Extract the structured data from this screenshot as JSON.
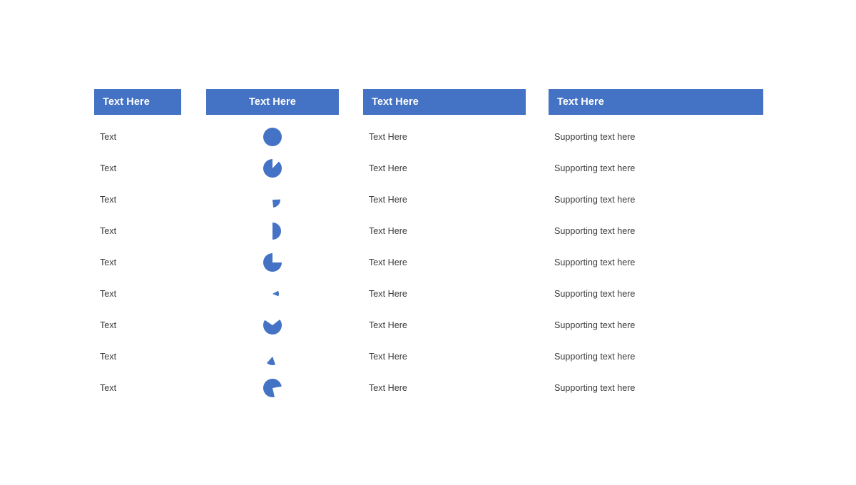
{
  "theme": {
    "accent_color": "#4472c4",
    "header_text_color": "#ffffff",
    "body_text_color": "#3b3b3b",
    "page_background": "#ffffff"
  },
  "table": {
    "headers": [
      {
        "label": "Text Here",
        "align": "left"
      },
      {
        "label": "Text Here",
        "align": "center"
      },
      {
        "label": "Text Here",
        "align": "left"
      },
      {
        "label": "Text Here",
        "align": "left"
      }
    ],
    "rows": [
      {
        "label": "Text",
        "middle": "Text Here",
        "support": "Supporting text here"
      },
      {
        "label": "Text",
        "middle": "Text Here",
        "support": "Supporting text here"
      },
      {
        "label": "Text",
        "middle": "Text Here",
        "support": "Supporting text here"
      },
      {
        "label": "Text",
        "middle": "Text Here",
        "support": "Supporting text here"
      },
      {
        "label": "Text",
        "middle": "Text Here",
        "support": "Supporting text here"
      },
      {
        "label": "Text",
        "middle": "Text Here",
        "support": "Supporting text here"
      },
      {
        "label": "Text",
        "middle": "Text Here",
        "support": "Supporting text here"
      },
      {
        "label": "Text",
        "middle": "Text Here",
        "support": "Supporting text here"
      },
      {
        "label": "Text",
        "middle": "Text Here",
        "support": "Supporting text here"
      }
    ]
  },
  "chart_data": {
    "type": "pie",
    "title": "",
    "xlabel": "",
    "ylabel": "",
    "legend": [],
    "color": "#4472c4",
    "note": "One single-slice pie icon per table row; value is the filled fraction of the circle, start_deg measured clockwise from 12 o'clock.",
    "series": [
      {
        "name": "Row 1",
        "value": 100,
        "start_deg": 0,
        "radius_px": 13
      },
      {
        "name": "Row 2",
        "value": 88,
        "start_deg": 43,
        "radius_px": 13
      },
      {
        "name": "Row 3",
        "value": 24,
        "start_deg": 88,
        "radius_px": 11
      },
      {
        "name": "Row 4",
        "value": 50,
        "start_deg": 0,
        "radius_px": 12
      },
      {
        "name": "Row 5",
        "value": 75,
        "start_deg": 90,
        "radius_px": 13
      },
      {
        "name": "Row 6",
        "value": 14,
        "start_deg": 62,
        "radius_px": 9
      },
      {
        "name": "Row 7",
        "value": 70,
        "start_deg": 52,
        "radius_px": 13
      },
      {
        "name": "Row 8",
        "value": 17,
        "start_deg": 160,
        "radius_px": 12
      },
      {
        "name": "Row 9",
        "value": 76,
        "start_deg": 167,
        "radius_px": 13
      }
    ]
  }
}
